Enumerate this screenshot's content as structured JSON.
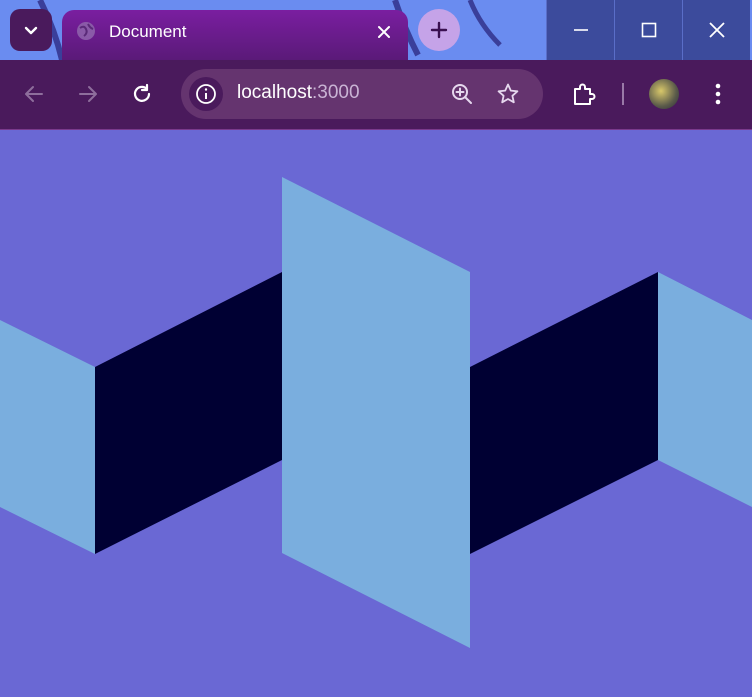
{
  "tab": {
    "title": "Document"
  },
  "toolbar": {
    "url_host": "localhost",
    "url_port": ":3000"
  },
  "colors": {
    "page_background": "#6a68d4",
    "light_panel": "#7aaede",
    "dark_panel": "#000033",
    "toolbar": "#4a1a5c",
    "tab_active": "#7a1ea0"
  },
  "icons": {
    "tab_search": "chevron-down-icon",
    "favicon": "globe-icon",
    "tab_close": "close-icon",
    "new_tab": "plus-icon",
    "minimize": "minimize-icon",
    "maximize": "maximize-icon",
    "close_window": "close-icon",
    "back": "arrow-left-icon",
    "forward": "arrow-right-icon",
    "reload": "reload-icon",
    "site_info": "info-icon",
    "zoom": "zoom-in-icon",
    "bookmark": "star-icon",
    "extensions": "puzzle-icon",
    "menu": "kebab-menu-icon"
  }
}
